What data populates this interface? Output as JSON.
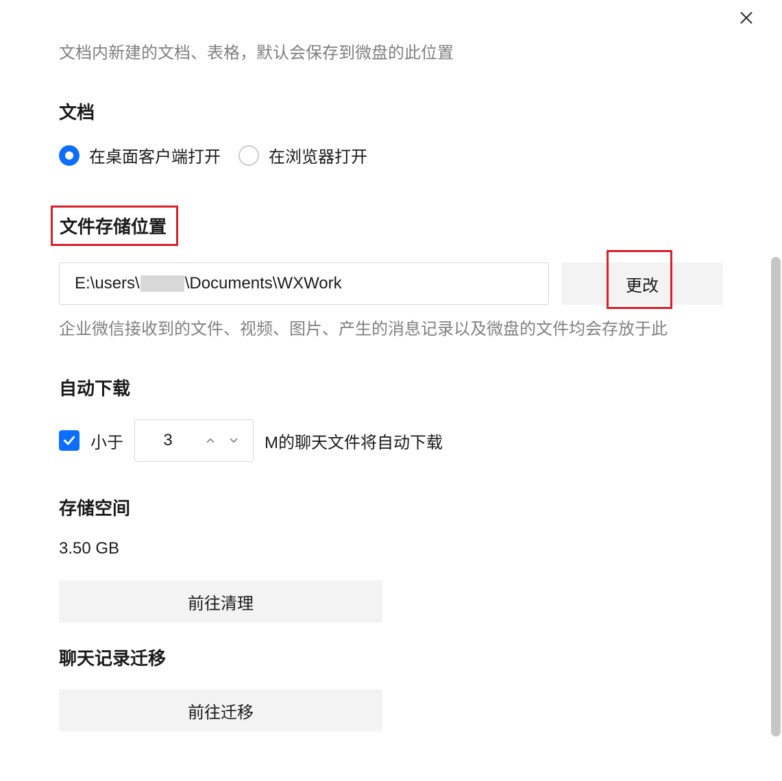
{
  "top_description": "文档内新建的文档、表格，默认会保存到微盘的此位置",
  "sections": {
    "document": {
      "title": "文档",
      "option_desktop": "在桌面客户端打开",
      "option_browser": "在浏览器打开"
    },
    "storage_location": {
      "title": "文件存储位置",
      "path_prefix": "E:\\users\\",
      "path_suffix": "\\Documents\\WXWork",
      "change_button": "更改",
      "description": "企业微信接收到的文件、视频、图片、产生的消息记录以及微盘的文件均会存放于此"
    },
    "auto_download": {
      "title": "自动下载",
      "prefix_label": "小于",
      "value": "3",
      "suffix_label": "M的聊天文件将自动下载"
    },
    "storage_space": {
      "title": "存储空间",
      "value": "3.50 GB",
      "cleanup_button": "前往清理"
    },
    "chat_migration": {
      "title": "聊天记录迁移",
      "migrate_button": "前往迁移"
    }
  }
}
